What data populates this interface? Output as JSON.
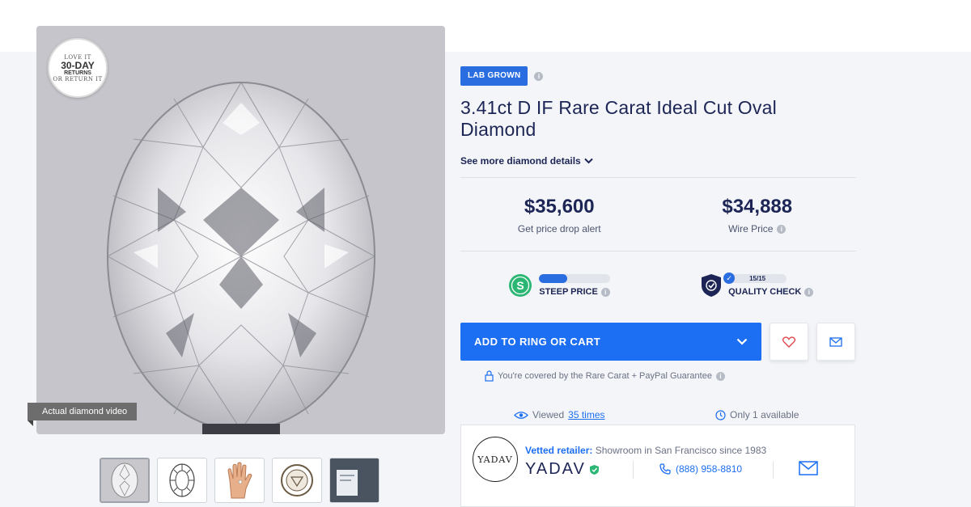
{
  "media": {
    "returns_badge": {
      "top": "LOVE IT",
      "big": "30-DAY",
      "mid": "RETURNS",
      "bottom": "OR RETURN IT"
    },
    "video_label": "Actual diamond video",
    "thumbnails": [
      "oval-diamond-photo",
      "oval-outline-diagram",
      "hand-size-view",
      "certificate-seal",
      "lab-report"
    ]
  },
  "product": {
    "badge": "LAB GROWN",
    "title": "3.41ct D IF Rare Carat Ideal Cut Oval Diamond",
    "see_more": "See more diamond details"
  },
  "prices": {
    "list": {
      "value": "$35,600",
      "label": "Get price drop alert"
    },
    "wire": {
      "value": "$34,888",
      "label": "Wire Price"
    }
  },
  "metrics": {
    "steep": {
      "label": "STEEP PRICE",
      "fraction": 0.4,
      "color": "#2bb673"
    },
    "quality": {
      "label": "QUALITY CHECK",
      "score": "15/15"
    }
  },
  "cart": {
    "label": "ADD TO RING OR CART",
    "guarantee": "You're covered by the Rare Carat + PayPal Guarantee"
  },
  "stats": {
    "viewed_prefix": "Viewed",
    "viewed_count": "35 times",
    "availability": "Only 1 available"
  },
  "retailer": {
    "vetted_label": "Vetted retailer:",
    "vetted_text": "Showroom in San Francisco since 1983",
    "name": "YADAV",
    "logo_text": "YADAV",
    "phone": "(888) 958-8810"
  },
  "colors": {
    "accent": "#1c6ef2",
    "navy": "#1c2555"
  }
}
